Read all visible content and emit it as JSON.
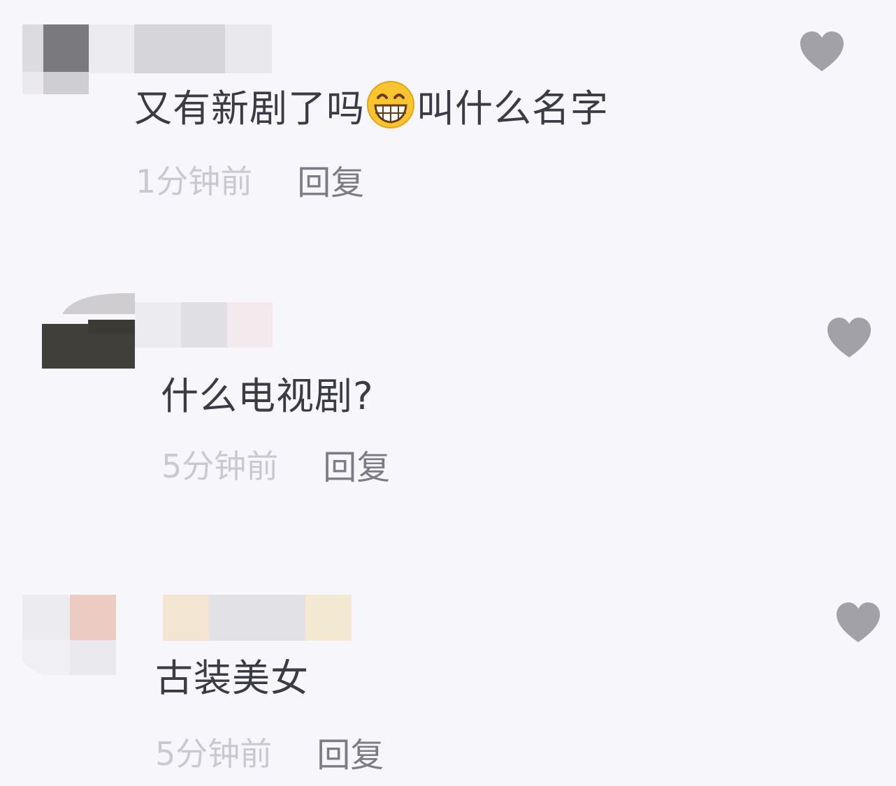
{
  "colors": {
    "background": "#f7f6fb",
    "text": "#3b3b45",
    "timestamp": "#c9c8d3",
    "reply": "#7d7c86",
    "heart": "#a2a1a8"
  },
  "icons": {
    "like": "heart-icon",
    "emoji": "grinning-face-icon"
  },
  "comments": [
    {
      "text_before": "又有新剧了吗",
      "emoji": "grinning-face-icon",
      "text_after": "叫什么名字",
      "time": "1分钟前",
      "reply": "回复"
    },
    {
      "text": "什么电视剧?",
      "time": "5分钟前",
      "reply": "回复"
    },
    {
      "text": "古装美女",
      "time": "5分钟前",
      "reply": "回复"
    }
  ]
}
